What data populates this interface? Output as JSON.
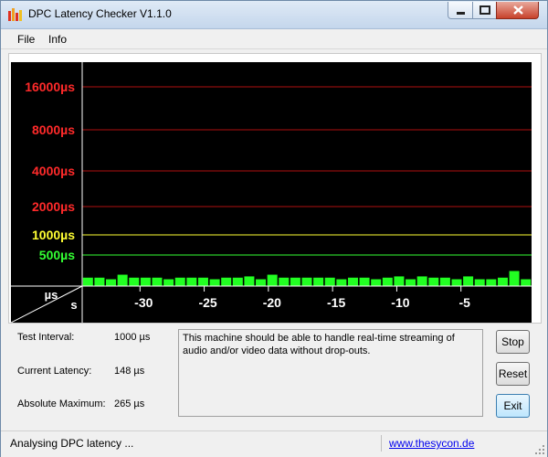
{
  "window": {
    "title": "DPC Latency Checker V1.1.0"
  },
  "menu": {
    "file": "File",
    "info": "Info"
  },
  "chart_data": {
    "type": "bar",
    "y_axis_labels": [
      {
        "label": "16000µs",
        "value": 16000,
        "color": "#ff2a2a"
      },
      {
        "label": "8000µs",
        "value": 8000,
        "color": "#ff2a2a"
      },
      {
        "label": "4000µs",
        "value": 4000,
        "color": "#ff2a2a"
      },
      {
        "label": "2000µs",
        "value": 2000,
        "color": "#ff2a2a"
      },
      {
        "label": "1000µs",
        "value": 1000,
        "color": "#ffff33"
      },
      {
        "label": "500µs",
        "value": 500,
        "color": "#33ff33"
      }
    ],
    "x_axis_ticks": [
      "-30",
      "-25",
      "-20",
      "-15",
      "-10",
      "-5"
    ],
    "x_tick_values": [
      -30,
      -25,
      -20,
      -15,
      -10,
      -5
    ],
    "x_range": [
      -35,
      0
    ],
    "corner_label_top": "µs",
    "corner_label_bottom": "s",
    "bar_color": "#22ff22",
    "values": [
      148,
      148,
      120,
      200,
      148,
      148,
      148,
      120,
      148,
      148,
      148,
      120,
      148,
      148,
      170,
      120,
      200,
      148,
      148,
      148,
      148,
      148,
      120,
      148,
      148,
      120,
      148,
      170,
      120,
      170,
      148,
      148,
      120,
      170,
      120,
      120,
      148,
      265,
      120
    ]
  },
  "info": {
    "test_interval_label": "Test Interval:",
    "test_interval_value": "1000 µs",
    "current_latency_label": "Current Latency:",
    "current_latency_value": "148 µs",
    "absolute_maximum_label": "Absolute Maximum:",
    "absolute_maximum_value": "265 µs",
    "message": "This machine should be able to handle real-time streaming of audio and/or video data without drop-outs."
  },
  "buttons": {
    "stop": "Stop",
    "reset": "Reset",
    "exit": "Exit"
  },
  "status": {
    "text": "Analysing DPC latency ...",
    "link": "www.thesycon.de"
  }
}
